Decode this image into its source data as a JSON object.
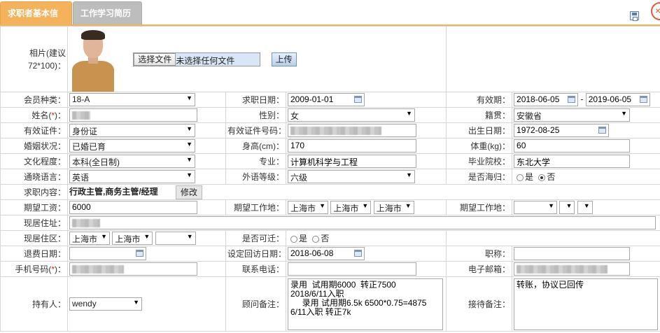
{
  "tabs": {
    "basic": "求职者基本信息",
    "resume": "工作学习简历"
  },
  "photo": {
    "label": "相片(建议72*100)：",
    "file_button": "选择文件",
    "file_status": "未选择任何文件",
    "upload": "上传"
  },
  "row1": {
    "member_label": "会员种类：",
    "member_value": "18-A",
    "apply_date_label": "求职日期：",
    "apply_date": "2009-01-01",
    "valid_label": "有效期：",
    "valid_from": "2018-06-05",
    "valid_sep": "-",
    "valid_to": "2019-06-05"
  },
  "row2": {
    "name_label": "姓名(",
    "name_req": "*",
    "name_label_end": ")：",
    "gender_label": "性别：",
    "gender": "女",
    "native_label": "籍贯：",
    "native": "安徽省"
  },
  "row3": {
    "id_type_label": "有效证件：",
    "id_type": "身份证",
    "id_no_label": "有效证件号码：",
    "birth_label": "出生日期：",
    "birth": "1972-08-25"
  },
  "row4": {
    "marital_label": "婚姻状况：",
    "marital": "已婚已育",
    "height_label": "身高(cm)：",
    "height": "170",
    "weight_label": "体重(kg)：",
    "weight": "60"
  },
  "row5": {
    "edu_label": "文化程度：",
    "edu": "本科(全日制)",
    "major_label": "专业：",
    "major": "计算机科学与工程",
    "school_label": "毕业院校：",
    "school": "东北大学"
  },
  "row6": {
    "lang_label": "通晓语言：",
    "lang": "英语",
    "lang_level_label": "外语等级：",
    "lang_level": "六级",
    "overseas_label": "是否海归：",
    "yes": "是",
    "no": "否"
  },
  "row7": {
    "job_label": "求职内容：",
    "job": "行政主管,商务主管/经理",
    "edit": "修改"
  },
  "row8": {
    "salary_label": "期望工资：",
    "salary": "6000",
    "loc1_label": "期望工作地：",
    "loc1_a": "上海市",
    "loc1_b": "上海市",
    "loc1_c": "上海市",
    "loc2_label": "期望工作地："
  },
  "row9": {
    "addr_label": "现居住址："
  },
  "row10": {
    "area_label": "现居住区：",
    "area_a": "上海市",
    "area_b": "上海市",
    "move_label": "是否可迁：",
    "yes": "是",
    "no": "否"
  },
  "row11": {
    "refund_label": "退费日期：",
    "revisit_label": "设定回访日期：",
    "revisit": "2018-06-08",
    "title_label": "职称："
  },
  "row12": {
    "phone_label": "手机号码(",
    "phone_req": "*",
    "phone_label_end": ")：",
    "contact_label": "联系电话：",
    "email_label": "电子邮箱："
  },
  "row13": {
    "holder_label": "持有人：",
    "holder": "wendy",
    "advisor_label": "顾问备注：",
    "advisor_note": "录用  试用期6000  转正7500\n2018/6/11入职\n     录用 试用期6.5k 6500*0.75=4875\n6/11入职 转正7k",
    "reception_label": "接待备注：",
    "reception_note": "转账，协议已回传"
  },
  "colors": {
    "accent": "#f4b25b",
    "required": "#dd2222"
  }
}
